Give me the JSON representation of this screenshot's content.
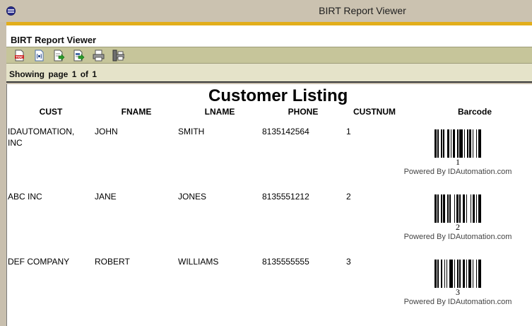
{
  "window": {
    "title": "BIRT Report Viewer"
  },
  "app": {
    "title": "BIRT Report Viewer"
  },
  "toolbar": {
    "buttons": [
      {
        "name": "toc-icon"
      },
      {
        "name": "run-report-icon"
      },
      {
        "name": "export-data-icon"
      },
      {
        "name": "export-report-icon"
      },
      {
        "name": "print-icon"
      },
      {
        "name": "print-server-icon"
      }
    ]
  },
  "navbar": {
    "showing_label": "Showing page",
    "current_page": "1",
    "of_label": "of",
    "total_pages": "1"
  },
  "report": {
    "title": "Customer Listing",
    "columns": [
      "CUST",
      "FNAME",
      "LNAME",
      "PHONE",
      "CUSTNUM",
      "Barcode"
    ],
    "rows": [
      {
        "cust": "IDAUTOMATION, INC",
        "fname": "JOHN",
        "lname": "SMITH",
        "phone": "8135142564",
        "custnum": "1",
        "barcode_text": "1",
        "powered_by": "Powered By IDAutomation.com"
      },
      {
        "cust": "ABC INC",
        "fname": "JANE",
        "lname": "JONES",
        "phone": "8135551212",
        "custnum": "2",
        "barcode_text": "2",
        "powered_by": "Powered By IDAutomation.com"
      },
      {
        "cust": "DEF COMPANY",
        "fname": "ROBERT",
        "lname": "WILLIAMS",
        "phone": "8135555555",
        "custnum": "3",
        "barcode_text": "3",
        "powered_by": "Powered By IDAutomation.com"
      }
    ]
  }
}
